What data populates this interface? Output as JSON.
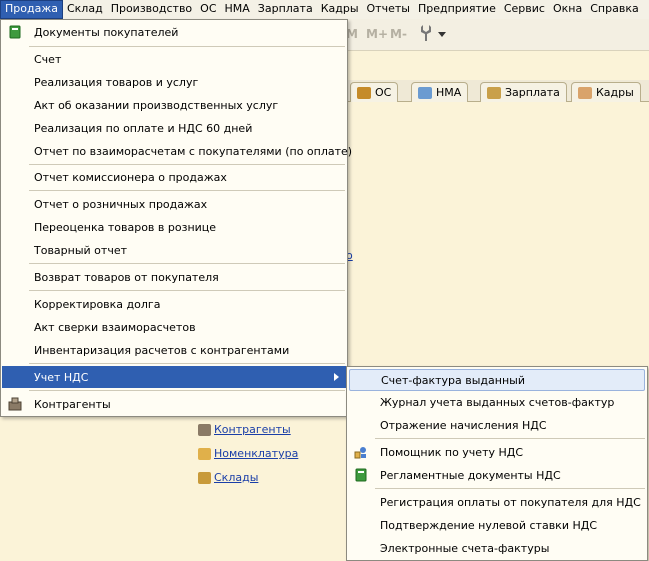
{
  "menubar": {
    "items": [
      "Продажа",
      "Склад",
      "Производство",
      "ОС",
      "НМА",
      "Зарплата",
      "Кадры",
      "Отчеты",
      "Предприятие",
      "Сервис",
      "Окна",
      "Справка"
    ]
  },
  "toolbar": {
    "memory_buttons": [
      "M",
      "M+",
      "M-"
    ],
    "tool_icon": "wrench-icon"
  },
  "tabs": [
    {
      "label": "ОС",
      "icon": "truck-icon"
    },
    {
      "label": "НМА",
      "icon": "document-icon"
    },
    {
      "label": "Зарплата",
      "icon": "money-bag-icon"
    },
    {
      "label": "Кадры",
      "icon": "people-icon"
    }
  ],
  "content": {
    "fragment_text": "о",
    "links": [
      {
        "label": "Контрагенты",
        "icon": "contragents-icon"
      },
      {
        "label": "Номенклатура",
        "icon": "nomenclature-icon"
      },
      {
        "label": "Склады",
        "icon": "warehouse-icon"
      }
    ]
  },
  "sales_menu": {
    "items": [
      {
        "label": "Документы покупателей",
        "icon": "book-icon"
      },
      {
        "label": "Счет"
      },
      {
        "label": "Реализация товаров и услуг"
      },
      {
        "label": "Акт об оказании производственных услуг"
      },
      {
        "label": "Реализация по оплате и НДС 60 дней"
      },
      {
        "label": "Отчет по взаиморасчетам с покупателями (по оплате)"
      },
      {
        "label": "Отчет комиссионера о продажах"
      },
      {
        "label": "Отчет о розничных продажах"
      },
      {
        "label": "Переоценка товаров в рознице"
      },
      {
        "label": "Товарный отчет"
      },
      {
        "label": "Возврат товаров от покупателя"
      },
      {
        "label": "Корректировка долга"
      },
      {
        "label": "Акт сверки взаиморасчетов"
      },
      {
        "label": "Инвентаризация расчетов с контрагентами"
      },
      {
        "label": "Учет НДС"
      },
      {
        "label": "Контрагенты",
        "icon": "contragents-icon"
      }
    ]
  },
  "vat_submenu": {
    "items": [
      {
        "label": "Счет-фактура выданный"
      },
      {
        "label": "Журнал учета выданных счетов-фактур"
      },
      {
        "label": "Отражение начисления НДС"
      },
      {
        "label": "Помощник по учету НДС",
        "icon": "assistant-icon"
      },
      {
        "label": "Регламентные документы НДС",
        "icon": "book-icon"
      },
      {
        "label": "Регистрация оплаты от покупателя для НДС"
      },
      {
        "label": "Подтверждение нулевой ставки НДС"
      },
      {
        "label": "Электронные счета-фактуры"
      }
    ]
  },
  "colors": {
    "highlight": "#2f5fb1",
    "hover": "#e3ecf9",
    "link": "#1a3ea8",
    "background": "#fbf3d8"
  }
}
